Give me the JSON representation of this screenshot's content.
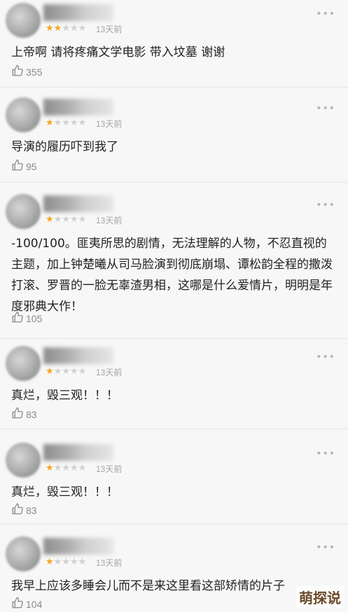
{
  "reviews": [
    {
      "rating": 2,
      "time": "13天前",
      "comment": "上帝啊 请将疼痛文学电影 带入坟墓 谢谢",
      "likes": "355"
    },
    {
      "rating": 1,
      "time": "13天前",
      "comment": "导演的履历吓到我了",
      "likes": "95"
    },
    {
      "rating": 1,
      "time": "13天前",
      "comment": "-100/100。匪夷所思的剧情，无法理解的人物，不忍直视的主题，加上钟楚曦从司马脸演到彻底崩塌、谭松韵全程的撒泼打滚、罗晋的一脸无辜渣男相，这哪是什么爱情片，明明是年度邪典大作！",
      "likes": "105"
    },
    {
      "rating": 1,
      "time": "13天前",
      "comment": "真烂，毁三观！！！",
      "likes": "83"
    },
    {
      "rating": 1,
      "time": "13天前",
      "comment": "真烂，毁三观！！！",
      "likes": "83"
    },
    {
      "rating": 1,
      "time": "13天前",
      "comment": "我早上应该多睡会儿而不是来这里看这部矫情的片子",
      "likes": "104"
    }
  ],
  "watermark": "萌探说",
  "colors": {
    "star_on": "#f5a623",
    "star_off": "#d0d0d0",
    "meta": "#a5a5a5"
  },
  "icons": {
    "like": "thumbs-up-icon",
    "more": "more-dots-icon"
  }
}
